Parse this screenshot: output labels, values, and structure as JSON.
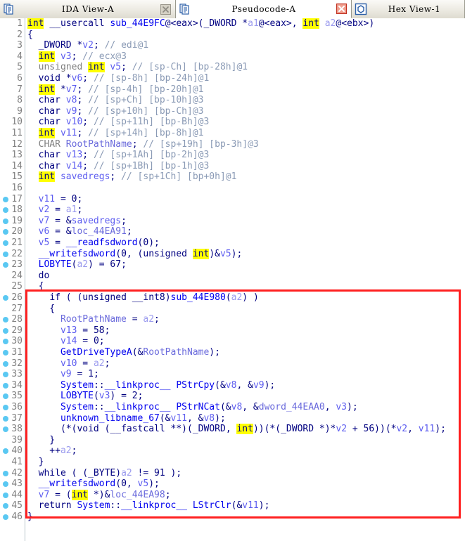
{
  "window": {
    "app": "IDA Pro",
    "view": "Pseudocode"
  },
  "tabs": [
    {
      "label": "IDA View-A",
      "icon": "document-icon",
      "active": false,
      "closable": true,
      "close_state": "disabled"
    },
    {
      "label": "Pseudocode-A",
      "icon": "document-icon",
      "active": true,
      "closable": true,
      "close_state": "enabled"
    },
    {
      "label": "Hex View-1",
      "icon": "hex-icon",
      "active": false,
      "closable": false,
      "close_state": "none"
    }
  ],
  "colors": {
    "keyword": "#000080",
    "keyword_highlight_bg": "#ffff00",
    "comment": "#8a9ab5",
    "function": "#0000ee",
    "local_var": "#5d5df0",
    "argument": "#9a9aee",
    "global": "#6a6adc",
    "breakpoint_dot": "#5ac8f2",
    "line_number": "#808080",
    "annotation_box": "#ff2020",
    "background": "#ffffff"
  },
  "annotation": {
    "type": "rectangle",
    "color": "#ff2020",
    "covers_lines": [
      24,
      43
    ]
  },
  "code": {
    "function_signature": "int __usercall sub_44E9FC@<eax>(_DWORD *a1@<eax>, int a2@<ebx>)",
    "total_lines": 46,
    "lines": [
      {
        "n": 1,
        "dot": false,
        "text": "int __usercall sub_44E9FC@<eax>(_DWORD *a1@<eax>, int a2@<ebx>)"
      },
      {
        "n": 2,
        "dot": false,
        "text": "{"
      },
      {
        "n": 3,
        "dot": false,
        "text": "  _DWORD *v2; // edi@1"
      },
      {
        "n": 4,
        "dot": false,
        "text": "  int v3; // ecx@3"
      },
      {
        "n": 5,
        "dot": false,
        "text": "  unsigned int v5; // [sp-Ch] [bp-28h]@1"
      },
      {
        "n": 6,
        "dot": false,
        "text": "  void *v6; // [sp-8h] [bp-24h]@1"
      },
      {
        "n": 7,
        "dot": false,
        "text": "  int *v7; // [sp-4h] [bp-20h]@1"
      },
      {
        "n": 8,
        "dot": false,
        "text": "  char v8; // [sp+Ch] [bp-10h]@3"
      },
      {
        "n": 9,
        "dot": false,
        "text": "  char v9; // [sp+10h] [bp-Ch]@3"
      },
      {
        "n": 10,
        "dot": false,
        "text": "  char v10; // [sp+11h] [bp-Bh]@3"
      },
      {
        "n": 11,
        "dot": false,
        "text": "  int v11; // [sp+14h] [bp-8h]@1"
      },
      {
        "n": 12,
        "dot": false,
        "text": "  CHAR RootPathName; // [sp+19h] [bp-3h]@3"
      },
      {
        "n": 13,
        "dot": false,
        "text": "  char v13; // [sp+1Ah] [bp-2h]@3"
      },
      {
        "n": 14,
        "dot": false,
        "text": "  char v14; // [sp+1Bh] [bp-1h]@3"
      },
      {
        "n": 15,
        "dot": false,
        "text": "  int savedregs; // [sp+1Ch] [bp+0h]@1"
      },
      {
        "n": 16,
        "dot": false,
        "text": ""
      },
      {
        "n": 17,
        "dot": true,
        "text": "  v11 = 0;"
      },
      {
        "n": 18,
        "dot": true,
        "text": "  v2 = a1;"
      },
      {
        "n": 19,
        "dot": true,
        "text": "  v7 = &savedregs;"
      },
      {
        "n": 20,
        "dot": true,
        "text": "  v6 = &loc_44EA91;"
      },
      {
        "n": 21,
        "dot": true,
        "text": "  v5 = __readfsdword(0);"
      },
      {
        "n": 22,
        "dot": true,
        "text": "  __writefsdword(0, (unsigned int)&v5);"
      },
      {
        "n": 23,
        "dot": true,
        "text": "  LOBYTE(a2) = 67;"
      },
      {
        "n": 24,
        "dot": false,
        "text": "  do"
      },
      {
        "n": 25,
        "dot": false,
        "text": "  {"
      },
      {
        "n": 26,
        "dot": true,
        "text": "    if ( (unsigned __int8)sub_44E980(a2) )"
      },
      {
        "n": 27,
        "dot": false,
        "text": "    {"
      },
      {
        "n": 28,
        "dot": true,
        "text": "      RootPathName = a2;"
      },
      {
        "n": 29,
        "dot": true,
        "text": "      v13 = 58;"
      },
      {
        "n": 30,
        "dot": true,
        "text": "      v14 = 0;"
      },
      {
        "n": 31,
        "dot": true,
        "text": "      GetDriveTypeA(&RootPathName);"
      },
      {
        "n": 32,
        "dot": true,
        "text": "      v10 = a2;"
      },
      {
        "n": 33,
        "dot": true,
        "text": "      v9 = 1;"
      },
      {
        "n": 34,
        "dot": true,
        "text": "      System::__linkproc__ PStrCpy(&v8, &v9);"
      },
      {
        "n": 35,
        "dot": true,
        "text": "      LOBYTE(v3) = 2;"
      },
      {
        "n": 36,
        "dot": true,
        "text": "      System::__linkproc__ PStrNCat(&v8, &dword_44EAA0, v3);"
      },
      {
        "n": 37,
        "dot": true,
        "text": "      unknown_libname_67(&v11, &v8);"
      },
      {
        "n": 38,
        "dot": true,
        "text": "      (*(void (__fastcall **)(_DWORD, int))(*(_DWORD *)*v2 + 56))(*v2, v11);"
      },
      {
        "n": 39,
        "dot": false,
        "text": "    }"
      },
      {
        "n": 40,
        "dot": true,
        "text": "    ++a2;"
      },
      {
        "n": 41,
        "dot": false,
        "text": "  }"
      },
      {
        "n": 42,
        "dot": true,
        "text": "  while ( (_BYTE)a2 != 91 );"
      },
      {
        "n": 43,
        "dot": true,
        "text": "  __writefsdword(0, v5);"
      },
      {
        "n": 44,
        "dot": true,
        "text": "  v7 = (int *)&loc_44EA98;"
      },
      {
        "n": 45,
        "dot": true,
        "text": "  return System::__linkproc__ LStrClr(&v11);"
      },
      {
        "n": 46,
        "dot": true,
        "text": "}"
      }
    ]
  }
}
